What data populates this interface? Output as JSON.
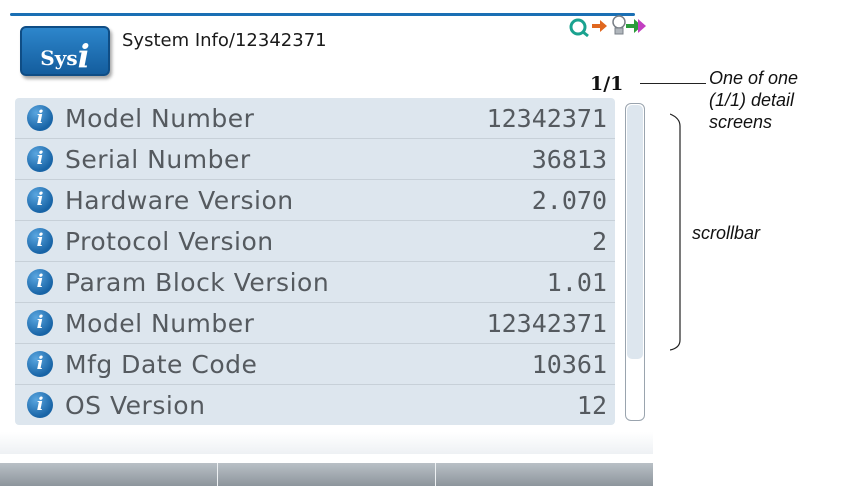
{
  "header": {
    "app_icon_prefix": "Sys",
    "app_icon_glyph": "i",
    "title": "System Info/12342371",
    "status_icons": [
      "search-icon",
      "arrow-right-icon",
      "lightbulb-icon",
      "connection-icon"
    ],
    "accent_color": "#1a6fb4"
  },
  "page_indicator": "1/1",
  "info_list": [
    {
      "label": "Model Number",
      "value": "12342371"
    },
    {
      "label": "Serial Number",
      "value": "36813"
    },
    {
      "label": "Hardware Version",
      "value": "2.070"
    },
    {
      "label": "Protocol Version",
      "value": "2"
    },
    {
      "label": "Param Block Version",
      "value": "1.01"
    },
    {
      "label": "Model Number",
      "value": "12342371"
    },
    {
      "label": "Mfg Date Code",
      "value": "10361"
    },
    {
      "label": "OS Version",
      "value": "12"
    }
  ],
  "info_icon_glyph": "i",
  "annotations": {
    "page_indicator_note": "One of one (1/1) detail screens",
    "scrollbar_note": "scrollbar"
  },
  "softkeys": [
    "",
    "",
    ""
  ]
}
